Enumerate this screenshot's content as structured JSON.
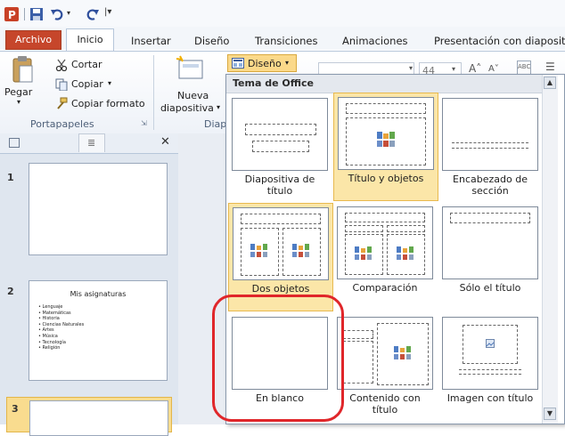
{
  "quick_access": {
    "icons": [
      "powerpoint-icon",
      "save-icon",
      "undo-icon",
      "redo-icon",
      "customize-icon"
    ]
  },
  "tabs": [
    "Archivo",
    "Inicio",
    "Insertar",
    "Diseño",
    "Transiciones",
    "Animaciones",
    "Presentación con diaposit"
  ],
  "ribbon": {
    "paste": "Pegar",
    "cut": "Cortar",
    "copy": "Copiar",
    "format_painter": "Copiar formato",
    "clipboard_group": "Portapapeles",
    "new_slide_line1": "Nueva",
    "new_slide_line2": "diapositiva",
    "slides_group": "Diap",
    "layout_button": "Diseño",
    "font_size": "44"
  },
  "slides_pane": {
    "slides": [
      {
        "number": "1"
      },
      {
        "number": "2",
        "title": "Mis asignaturas",
        "bullets": [
          "Lenguaje",
          "Matemáticas",
          "Historia",
          "Ciencias Naturales",
          "Artes",
          "Música",
          "Tecnología",
          "Religión"
        ]
      },
      {
        "number": "3"
      }
    ]
  },
  "gallery": {
    "header": "Tema de Office",
    "layouts": [
      {
        "line1": "Diapositiva de",
        "line2": "título",
        "selected": false
      },
      {
        "line1": "Título y objetos",
        "line2": "",
        "selected": true
      },
      {
        "line1": "Encabezado de",
        "line2": "sección",
        "selected": false
      },
      {
        "line1": "Dos objetos",
        "line2": "",
        "selected": true
      },
      {
        "line1": "Comparación",
        "line2": "",
        "selected": false
      },
      {
        "line1": "Sólo el título",
        "line2": "",
        "selected": false
      },
      {
        "line1": "En blanco",
        "line2": "",
        "selected": false
      },
      {
        "line1": "Contenido con",
        "line2": "título",
        "selected": false
      },
      {
        "line1": "Imagen con título",
        "line2": "",
        "selected": false
      }
    ]
  },
  "colors": {
    "file_tab": "#c6462b",
    "selection": "#fbe6a8",
    "highlight": "#e0262a"
  }
}
